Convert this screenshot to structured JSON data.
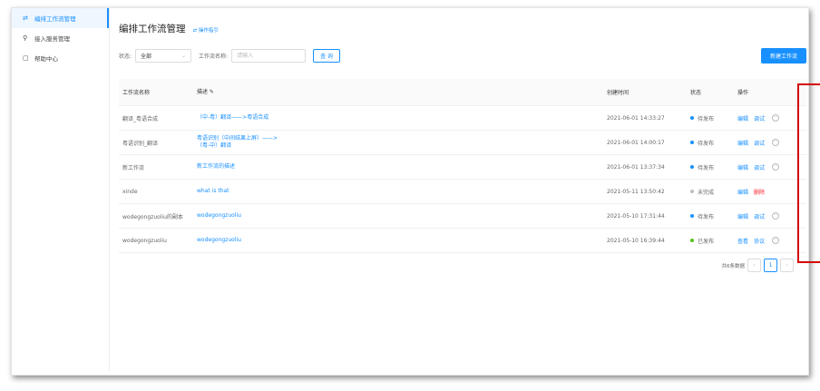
{
  "sidebar": {
    "items": [
      {
        "icon": "flow-icon",
        "glyph": "⇄",
        "label": "编排工作流管理",
        "active": true
      },
      {
        "icon": "link-icon",
        "glyph": "⚲",
        "label": "接入服务管理",
        "active": false
      },
      {
        "icon": "calendar-icon",
        "glyph": "▢",
        "label": "帮助中心",
        "active": false
      }
    ]
  },
  "header": {
    "title": "编排工作流管理",
    "guide_icon": "⇄",
    "guide": "操作指引"
  },
  "filters": {
    "status_label": "状态:",
    "status_value": "全部",
    "name_label": "工作流名称:",
    "name_placeholder": "请输入",
    "query_label": "查 询",
    "new_label": "新建工作流"
  },
  "table": {
    "headers": {
      "name": "工作流名称",
      "desc": "描述 ✎",
      "time": "创建时间",
      "status": "状态",
      "ops": "操作"
    },
    "rows": [
      {
        "name": "翻译_粤语合成",
        "desc": "（中-粤）翻译——>粤语合成",
        "desc2": "",
        "time": "2021-06-01 14:33:27",
        "status": "待发布",
        "status_color": "#1890ff",
        "op1": "编辑",
        "op2": "调试",
        "op2_danger": false,
        "more": "⋯"
      },
      {
        "name": "粤语识别_翻译",
        "desc": "粤语识别（中间结果上屏）——>",
        "desc2": "（粤-中）翻译",
        "time": "2021-06-01 14:00:17",
        "status": "待发布",
        "status_color": "#1890ff",
        "op1": "编辑",
        "op2": "调试",
        "op2_danger": false,
        "more": "⋯"
      },
      {
        "name": "新工作流",
        "desc": "新工作流的描述",
        "desc2": "",
        "time": "2021-06-01 13:37:34",
        "status": "待发布",
        "status_color": "#1890ff",
        "op1": "编辑",
        "op2": "调试",
        "op2_danger": false,
        "more": "⋯"
      },
      {
        "name": "xinde",
        "desc": "what is that",
        "desc2": "",
        "time": "2021-05-11 13:50:42",
        "status": "未完成",
        "status_color": "#bfbfbf",
        "op1": "编辑",
        "op2": "删除",
        "op2_danger": true,
        "more": ""
      },
      {
        "name": "wodegongzuoliu的副本",
        "desc": "wodegongzuoliu",
        "desc2": "",
        "time": "2021-05-10 17:31:44",
        "status": "待发布",
        "status_color": "#1890ff",
        "op1": "编辑",
        "op2": "调试",
        "op2_danger": false,
        "more": "⋯"
      },
      {
        "name": "wodegongzuoliu",
        "desc": "wodegongzuoliu",
        "desc2": "",
        "time": "2021-05-10 16:39:44",
        "status": "已发布",
        "status_color": "#52c41a",
        "op1": "查看",
        "op2": "协议",
        "op2_danger": false,
        "more": "⋯"
      }
    ]
  },
  "pagination": {
    "total": "共6条数据",
    "prev": "‹",
    "page": "1",
    "next": "›"
  },
  "colors": {
    "accent": "#1890ff",
    "highlight": "#d40000"
  }
}
